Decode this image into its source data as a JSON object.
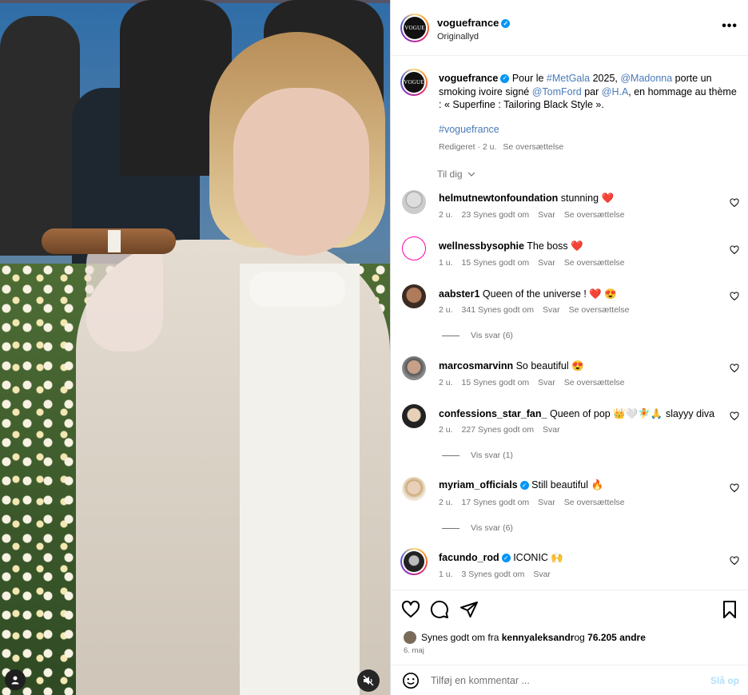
{
  "post": {
    "username": "voguefrance",
    "audio": "Originallyd",
    "avatar_text": "VOGUE",
    "more": "•••"
  },
  "caption": {
    "username": "voguefrance",
    "parts": {
      "t1": "Pour le ",
      "metgala": "#MetGala",
      "t2": " 2025, ",
      "madonna": "@Madonna",
      "t3": " porte un smoking ivoire signé ",
      "tomford": "@TomFord",
      "t4": " par ",
      "ha": "@H.A",
      "t5": ", en hommage au thème : « Superfine : Tailoring Black Style »."
    },
    "hashtag": "#voguefrance",
    "edited": "Redigeret · 2 u.",
    "translate": "Se oversættelse"
  },
  "sort_label": "Til dig",
  "comments": [
    {
      "user": "helmutnewtonfoundation",
      "text": "stunning",
      "emoji": "❤️",
      "time": "2 u.",
      "likes": "23 Synes godt om",
      "reply": "Svar",
      "translate": "Se oversættelse",
      "verified": false
    },
    {
      "user": "wellnessbysophie",
      "text": "The boss",
      "emoji": "❤️",
      "time": "1 u.",
      "likes": "15 Synes godt om",
      "reply": "Svar",
      "translate": "Se oversættelse",
      "verified": false
    },
    {
      "user": "aabster1",
      "text": "Queen of the universe !",
      "emoji": "❤️ 😍",
      "time": "2 u.",
      "likes": "341 Synes godt om",
      "reply": "Svar",
      "translate": "Se oversættelse",
      "verified": false,
      "replies": "Vis svar (6)"
    },
    {
      "user": "marcosmarvinn",
      "text": "So beautiful",
      "emoji": "😍",
      "time": "2 u.",
      "likes": "15 Synes godt om",
      "reply": "Svar",
      "translate": "Se oversættelse",
      "verified": false
    },
    {
      "user": "confessions_star_fan_",
      "text": "Queen of pop",
      "emoji": "👑🤍🧚🙏 slayyy diva",
      "time": "2 u.",
      "likes": "227 Synes godt om",
      "reply": "Svar",
      "translate": "",
      "verified": false,
      "replies": "Vis svar (1)"
    },
    {
      "user": "myriam_officials",
      "text": "Still beautiful",
      "emoji": "🔥",
      "time": "2 u.",
      "likes": "17 Synes godt om",
      "reply": "Svar",
      "translate": "Se oversættelse",
      "verified": true,
      "replies": "Vis svar (6)"
    },
    {
      "user": "facundo_rod",
      "text": "ICONIC",
      "emoji": "🙌",
      "time": "1 u.",
      "likes": "3 Synes godt om",
      "reply": "Svar",
      "translate": "",
      "verified": true
    }
  ],
  "likes": {
    "prefix": "Synes godt om fra ",
    "user": "kennyaleksandr",
    "mid": " og ",
    "count": "76.205 andre"
  },
  "date": "6. maj",
  "add_comment": {
    "placeholder": "Tilføj en kommentar ...",
    "post": "Slå op"
  },
  "colors": {
    "verified": "#0095f6",
    "link": "#385185",
    "muted": "#737373",
    "post_disabled": "#b2dffc"
  },
  "icons": {
    "like": "heart-icon",
    "comment": "comment-icon",
    "share": "share-icon",
    "save": "bookmark-icon",
    "emoji": "emoji-icon",
    "mute": "mute-icon",
    "tag": "person-tag-icon"
  }
}
